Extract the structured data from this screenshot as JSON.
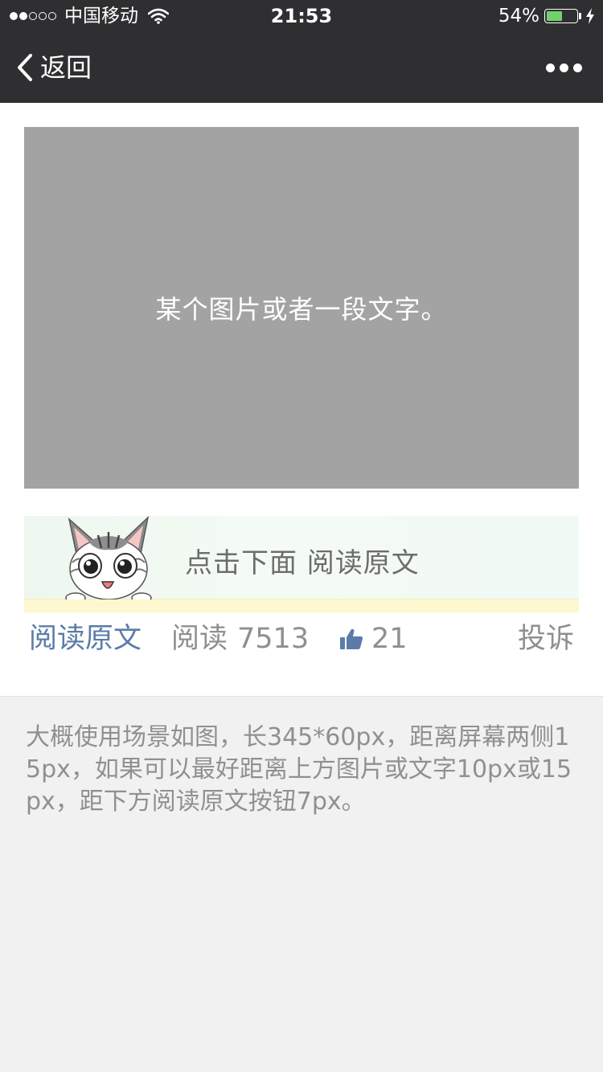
{
  "status_bar": {
    "carrier": "中国移动",
    "time": "21:53",
    "battery_percent": "54%",
    "battery_level": 0.54,
    "signal_strength": 2,
    "signal_max": 5,
    "icons": [
      "wifi-icon",
      "battery-icon",
      "charging-icon"
    ]
  },
  "nav": {
    "back_label": "返回",
    "icons": [
      "chevron-left-icon",
      "more-icon"
    ]
  },
  "placeholder": {
    "text": "某个图片或者一段文字。"
  },
  "banner": {
    "text": "点击下面  阅读原文",
    "image": "cat-illustration"
  },
  "footer": {
    "read_original": "阅读原文",
    "read_label": "阅读",
    "read_count": "7513",
    "like_count": "21",
    "report": "投诉",
    "link_color": "#5b7ca8"
  },
  "note": {
    "text": "大概使用场景如图，长345*60px，距离屏幕两侧15px，如果可以最好距离上方图片或文字10px或15px，距下方阅读原文按钮7px。"
  },
  "colors": {
    "nav_background": "#2f2f31",
    "placeholder_background": "#a3a3a3",
    "page_background": "#f1f1f1",
    "battery_fill": "#6fd36a"
  }
}
